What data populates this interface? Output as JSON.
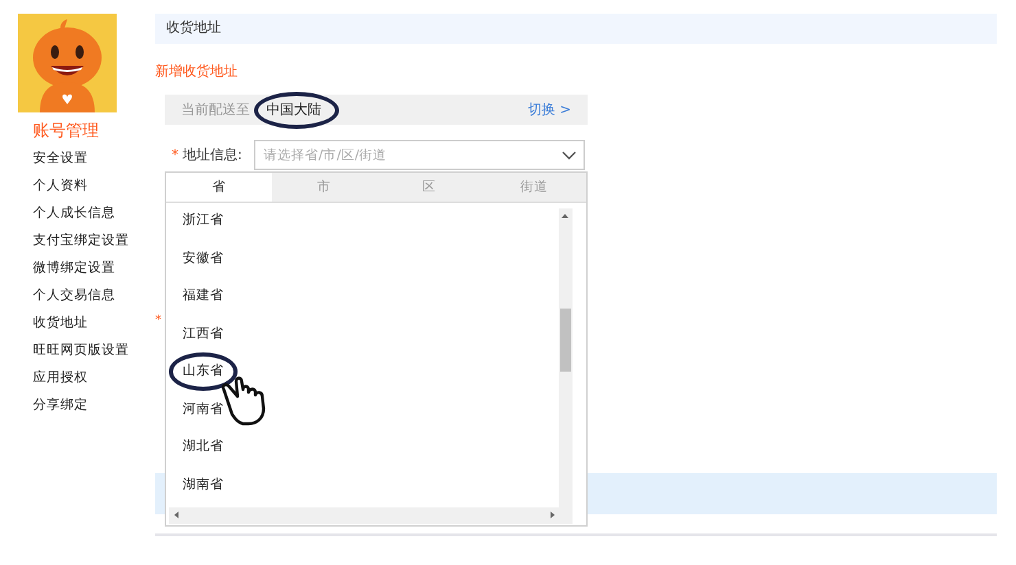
{
  "sidebar": {
    "heading": "账号管理",
    "items": [
      {
        "label": "安全设置",
        "selected": false
      },
      {
        "label": "个人资料",
        "selected": false
      },
      {
        "label": "个人成长信息",
        "selected": false
      },
      {
        "label": "支付宝绑定设置",
        "selected": false
      },
      {
        "label": "微博绑定设置",
        "selected": false
      },
      {
        "label": "个人交易信息",
        "selected": false
      },
      {
        "label": "收货地址",
        "selected": false
      },
      {
        "label": "旺旺网页版设置",
        "selected": false
      },
      {
        "label": "应用授权",
        "selected": false
      },
      {
        "label": "分享绑定",
        "selected": false
      }
    ]
  },
  "page_title": "收货地址",
  "add_link": "新增收货地址",
  "delivery": {
    "label": "当前配送至",
    "region": "中国大陆",
    "region_highlighted": true,
    "switch_link": "切换 >"
  },
  "address_field": {
    "required_mark": "*",
    "label": "地址信息:",
    "placeholder": "请选择省/市/区/街道"
  },
  "hidden_required_mark": "*",
  "dropdown": {
    "tabs": [
      {
        "label": "省",
        "selected": true
      },
      {
        "label": "市",
        "selected": false
      },
      {
        "label": "区",
        "selected": false
      },
      {
        "label": "街道",
        "selected": false
      }
    ],
    "items": [
      {
        "label": "浙江省",
        "highlighted": false
      },
      {
        "label": "安徽省",
        "highlighted": false
      },
      {
        "label": "福建省",
        "highlighted": false
      },
      {
        "label": "江西省",
        "highlighted": false
      },
      {
        "label": "山东省",
        "highlighted": true
      },
      {
        "label": "河南省",
        "highlighted": false
      },
      {
        "label": "湖北省",
        "highlighted": false
      },
      {
        "label": "湖南省",
        "highlighted": false
      }
    ]
  }
}
